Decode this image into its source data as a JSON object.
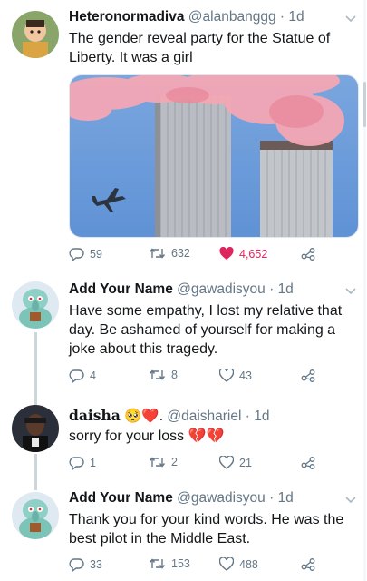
{
  "tweets": [
    {
      "name": "Heteronormadiva",
      "handle": "@alanbanggg",
      "dot": "·",
      "time": "1d",
      "text": "The gender reveal party for the Statue of Liberty. It was a girl",
      "replies": "59",
      "retweets": "632",
      "likes": "4,652",
      "liked": true
    },
    {
      "name": "Add Your Name",
      "handle": "@gawadisyou",
      "dot": "·",
      "time": "1d",
      "text": "Have some empathy, I lost my relative that day. Be ashamed of yourself for making a joke about this tragedy.",
      "replies": "4",
      "retweets": "8",
      "likes": "43"
    },
    {
      "name": "daisha",
      "name_emoji": "🥺❤️.",
      "handle": "@daishariel",
      "dot": "·",
      "time": "1d",
      "text": "sorry for your loss",
      "text_emoji": "💔💔",
      "replies": "1",
      "retweets": "2",
      "likes": "21"
    },
    {
      "name": "Add Your Name",
      "handle": "@gawadisyou",
      "dot": "·",
      "time": "1d",
      "text": "Thank you for your kind words. He was the best pilot in the Middle East.",
      "replies": "33",
      "retweets": "153",
      "likes": "488"
    }
  ],
  "colors": {
    "text": "#14171a",
    "muted": "#657786",
    "like": "#e0245e",
    "divider": "#e6ecf0"
  },
  "icons": [
    "reply-icon",
    "retweet-icon",
    "like-icon",
    "share-icon",
    "chevron-down-icon"
  ]
}
